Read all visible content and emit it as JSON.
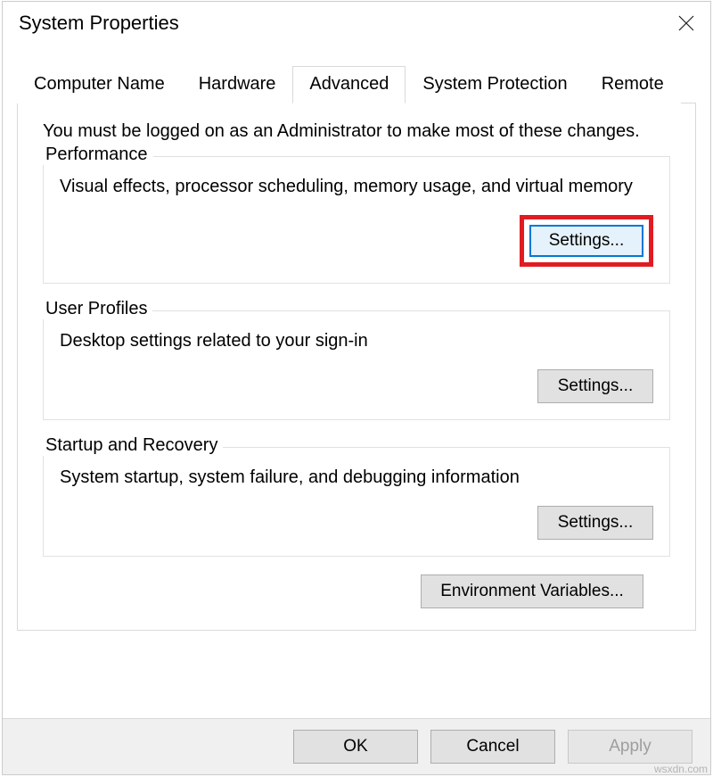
{
  "window": {
    "title": "System Properties"
  },
  "tabs": {
    "computer_name": "Computer Name",
    "hardware": "Hardware",
    "advanced": "Advanced",
    "system_protection": "System Protection",
    "remote": "Remote"
  },
  "advanced_page": {
    "admin_note": "You must be logged on as an Administrator to make most of these changes.",
    "performance": {
      "legend": "Performance",
      "desc": "Visual effects, processor scheduling, memory usage, and virtual memory",
      "settings_btn": "Settings..."
    },
    "user_profiles": {
      "legend": "User Profiles",
      "desc": "Desktop settings related to your sign-in",
      "settings_btn": "Settings..."
    },
    "startup_recovery": {
      "legend": "Startup and Recovery",
      "desc": "System startup, system failure, and debugging information",
      "settings_btn": "Settings..."
    },
    "env_vars_btn": "Environment Variables..."
  },
  "footer": {
    "ok": "OK",
    "cancel": "Cancel",
    "apply": "Apply"
  },
  "watermark": "wsxdn.com"
}
